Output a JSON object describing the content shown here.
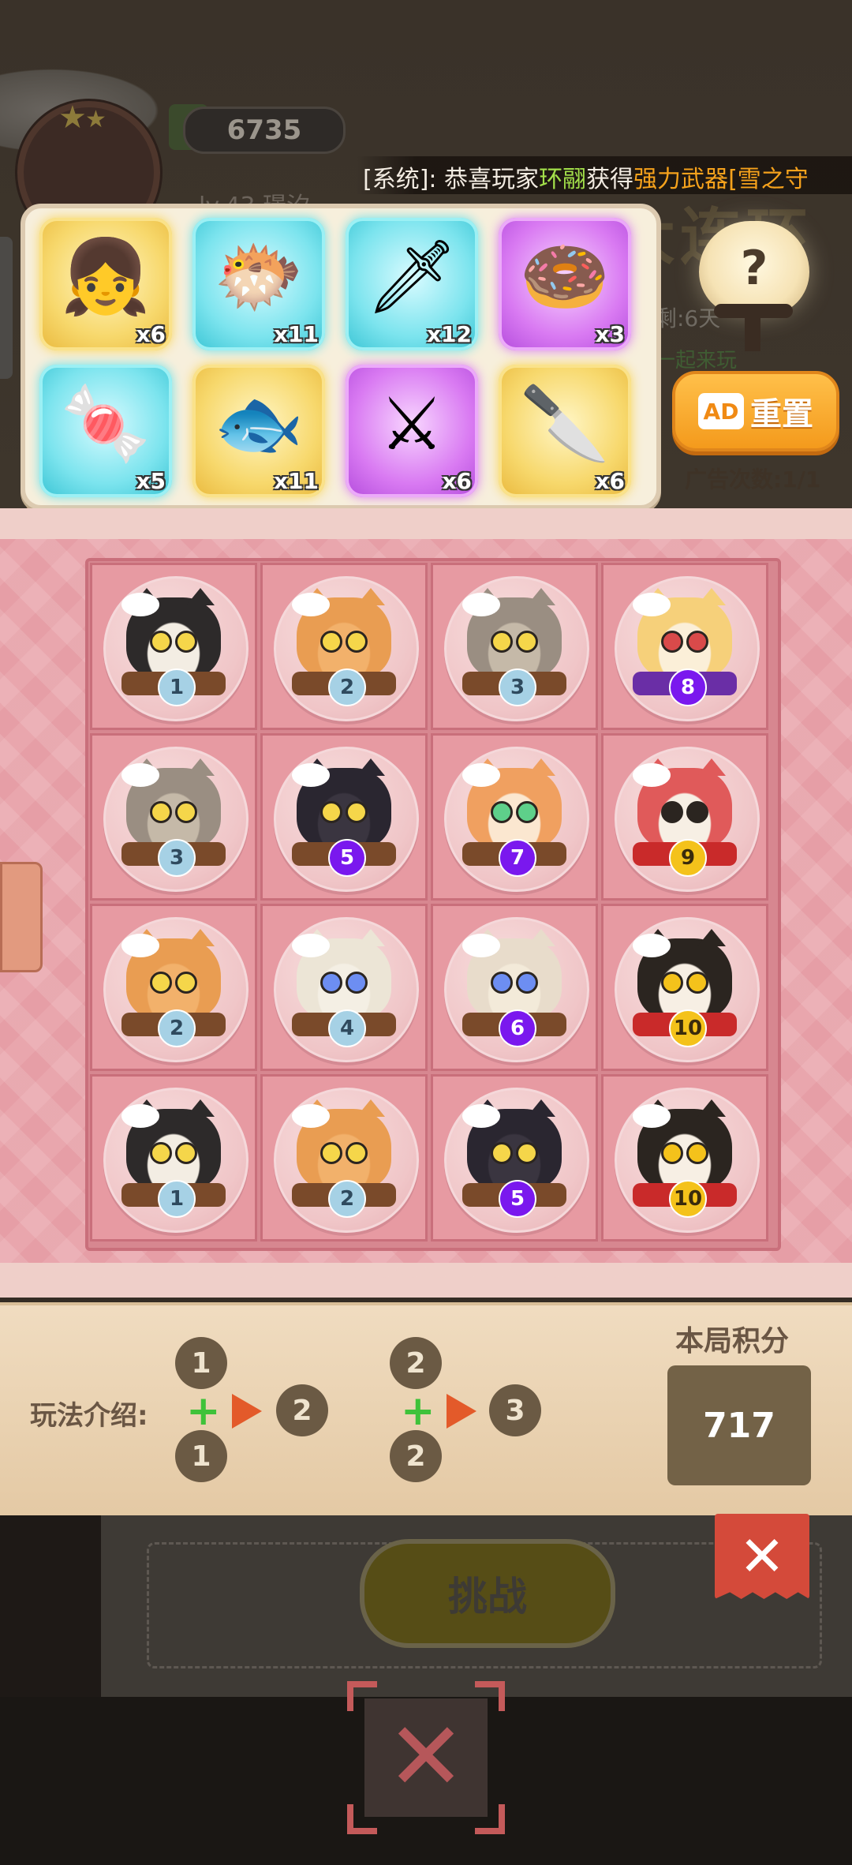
{
  "header": {
    "coins": "6735",
    "level": "lv.43",
    "player_name": "璟汐",
    "event_title": "丢沙大连环",
    "days_left": "剩:6天",
    "bg_hint": "一起来玩"
  },
  "ticker": {
    "prefix": "[系统]: 恭喜玩家",
    "player": "环翮",
    "middle": "获得",
    "reward": "强力武器",
    "item": "[雪之守"
  },
  "rewards": [
    {
      "icon": "princess-icon",
      "qty": "x6",
      "rarity": "gold"
    },
    {
      "icon": "pufferfish-icon",
      "qty": "x11",
      "rarity": "cyan"
    },
    {
      "icon": "red-sword-icon",
      "qty": "x12",
      "rarity": "cyan"
    },
    {
      "icon": "spiked-donut-icon",
      "qty": "x3",
      "rarity": "purple"
    },
    {
      "icon": "candy-icon",
      "qty": "x5",
      "rarity": "cyan"
    },
    {
      "icon": "fishbone-icon",
      "qty": "x11",
      "rarity": "gold"
    },
    {
      "icon": "wooden-sword-icon",
      "qty": "x6",
      "rarity": "purple"
    },
    {
      "icon": "claw-blade-icon",
      "qty": "x6",
      "rarity": "gold"
    }
  ],
  "reset": {
    "ad_badge": "AD",
    "label": "重置",
    "count_text": "广告次数:1/1"
  },
  "board": [
    [
      1,
      2,
      3,
      8
    ],
    [
      3,
      5,
      7,
      9
    ],
    [
      2,
      4,
      6,
      10
    ],
    [
      1,
      2,
      5,
      10
    ]
  ],
  "howto": {
    "label": "玩法介绍:",
    "rule1": {
      "a": "1",
      "b": "1",
      "result": "2"
    },
    "rule2": {
      "a": "2",
      "b": "2",
      "result": "3"
    }
  },
  "score": {
    "label": "本局积分",
    "value": "717"
  },
  "challenge_label": "挑战",
  "question_mark": "?",
  "colors": {
    "panel_bg": "#f7efdc",
    "board_pink": "#e9a6ad",
    "ad_orange": "#f49a1c",
    "close_red": "#d44a3a"
  }
}
